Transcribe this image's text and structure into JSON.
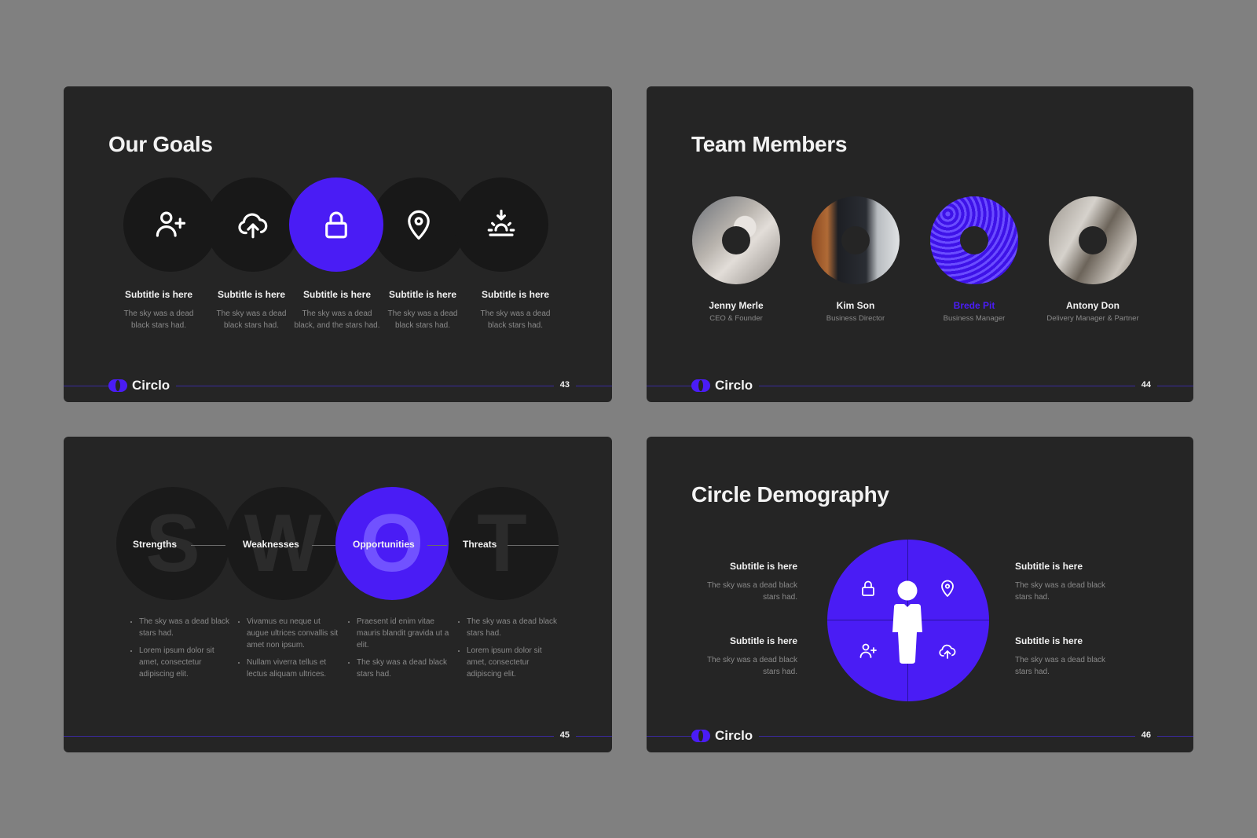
{
  "brand": {
    "name": "Circlo",
    "accent_color": "#4a1cf5",
    "slide_bg": "#252525",
    "page_bg": "#808080"
  },
  "slides": [
    {
      "page": "43",
      "title": "Our Goals",
      "show_logo": true,
      "goals": [
        {
          "icon": "user-plus-icon",
          "subtitle": "Subtitle is here",
          "desc": "The sky was a dead black stars had.",
          "active": false
        },
        {
          "icon": "cloud-upload-icon",
          "subtitle": "Subtitle is here",
          "desc": "The sky was a dead black stars had.",
          "active": false
        },
        {
          "icon": "lock-icon",
          "subtitle": "Subtitle is here",
          "desc": "The sky was a dead black, and the stars had.",
          "active": true
        },
        {
          "icon": "location-pin-icon",
          "subtitle": "Subtitle is here",
          "desc": "The sky was a dead black stars had.",
          "active": false
        },
        {
          "icon": "sunset-icon",
          "subtitle": "Subtitle is here",
          "desc": "The sky was a dead black stars had.",
          "active": false
        }
      ]
    },
    {
      "page": "44",
      "title": "Team Members",
      "show_logo": true,
      "members": [
        {
          "name": "Jenny Merle",
          "role": "CEO & Founder",
          "highlight": false
        },
        {
          "name": "Kim Son",
          "role": "Business Director",
          "highlight": false
        },
        {
          "name": "Brede Pit",
          "role": "Business Manager",
          "highlight": true
        },
        {
          "name": "Antony Don",
          "role": "Delivery Manager & Partner",
          "highlight": false
        }
      ]
    },
    {
      "page": "45",
      "show_logo": false,
      "swot": [
        {
          "letter": "S",
          "label": "Strengths",
          "active": false,
          "bullets": [
            "The sky was a dead black stars had.",
            "Lorem ipsum dolor sit amet, consectetur adipiscing elit."
          ]
        },
        {
          "letter": "W",
          "label": "Weaknesses",
          "active": false,
          "bullets": [
            "Vivamus eu neque ut augue ultrices convallis sit amet non ipsum.",
            "Nullam viverra tellus et lectus aliquam ultrices."
          ]
        },
        {
          "letter": "O",
          "label": "Opportunities",
          "active": true,
          "bullets": [
            "Praesent id enim vitae mauris blandit gravida ut a elit.",
            "The sky was a dead black stars had."
          ]
        },
        {
          "letter": "T",
          "label": "Threats",
          "active": false,
          "bullets": [
            "The sky was a dead black stars had.",
            "Lorem ipsum dolor sit amet, consectetur adipiscing elit."
          ]
        }
      ]
    },
    {
      "page": "46",
      "title": "Circle Demography",
      "show_logo": true,
      "quadrant_icons": [
        "lock-icon",
        "location-pin-icon",
        "user-plus-icon",
        "cloud-upload-icon"
      ],
      "center_icon": "person-icon",
      "texts": [
        {
          "subtitle": "Subtitle is here",
          "desc": "The sky was a dead black stars had."
        },
        {
          "subtitle": "Subtitle is here",
          "desc": "The sky was a dead black stars had."
        },
        {
          "subtitle": "Subtitle is here",
          "desc": "The sky was a dead black stars had."
        },
        {
          "subtitle": "Subtitle is here",
          "desc": "The sky was a dead black stars had."
        }
      ]
    }
  ]
}
